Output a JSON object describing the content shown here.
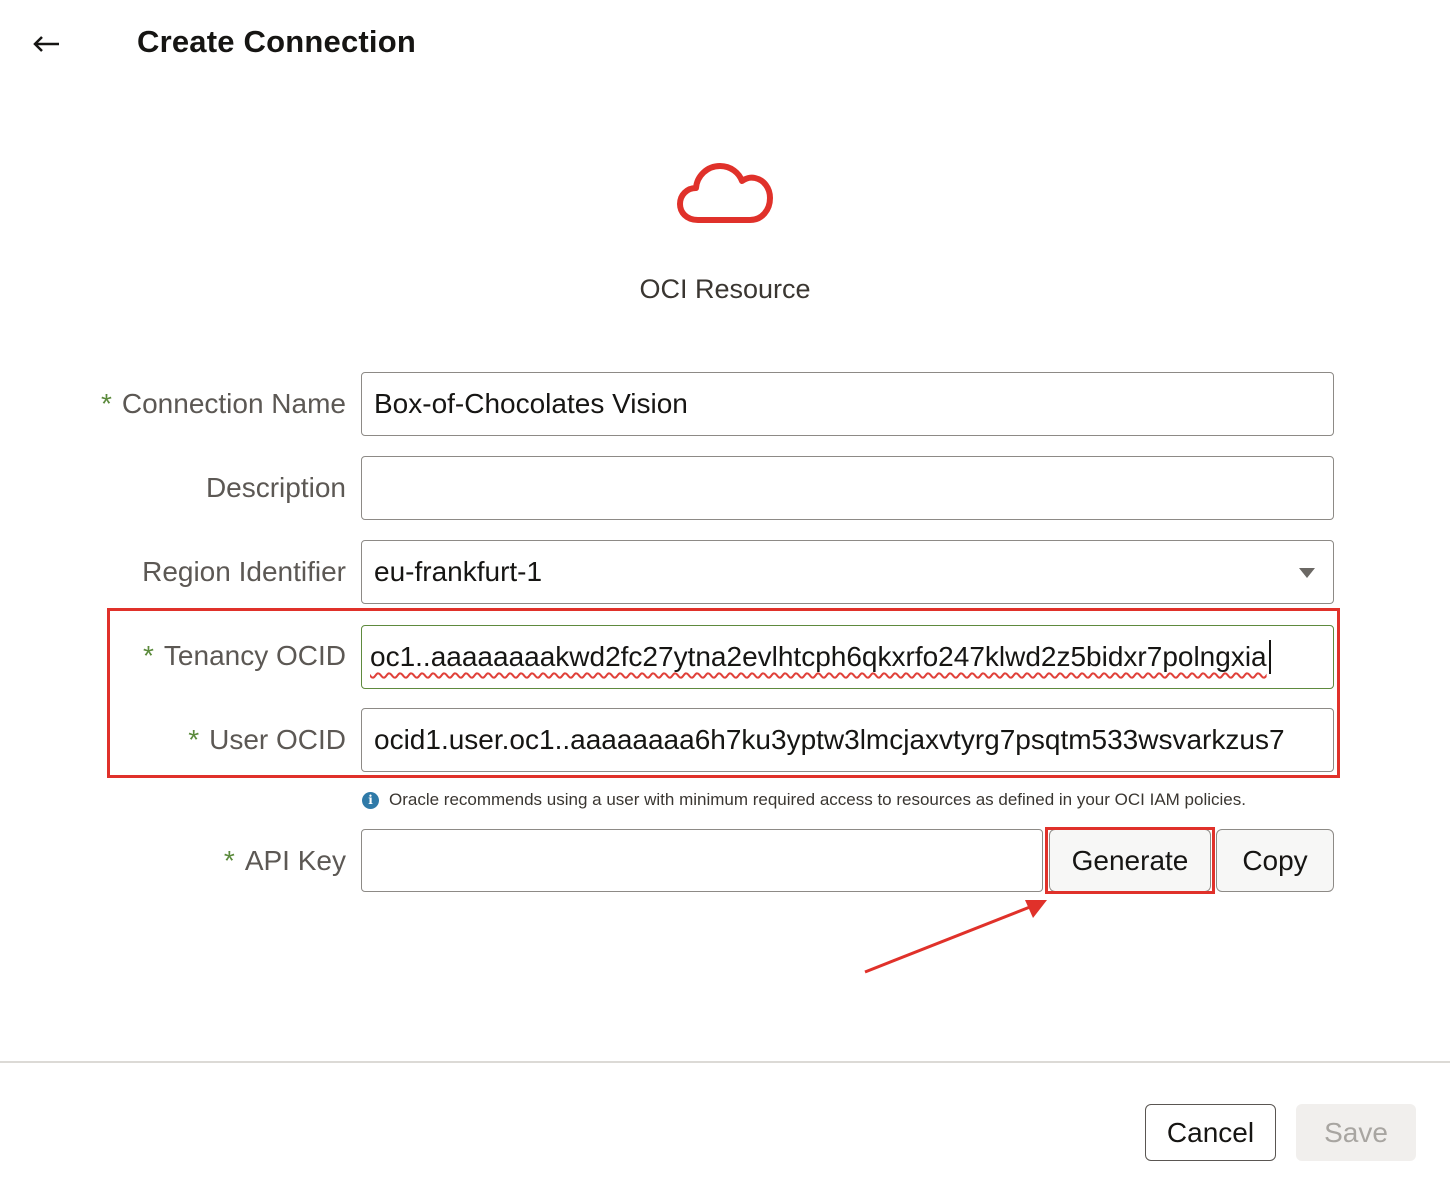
{
  "header": {
    "back_icon": "arrow-left-icon",
    "title": "Create Connection"
  },
  "resource": {
    "icon": "cloud-icon",
    "icon_color": "#e0312a",
    "label": "OCI Resource"
  },
  "form": {
    "required_marker": "*",
    "connection_name": {
      "label": "Connection Name",
      "value": "Box-of-Chocolates Vision"
    },
    "description": {
      "label": "Description",
      "value": ""
    },
    "region": {
      "label": "Region Identifier",
      "value": "eu-frankfurt-1"
    },
    "tenancy_ocid": {
      "label": "Tenancy OCID",
      "value": "oc1..aaaaaaaakwd2fc27ytna2evlhtcph6qkxrfo247klwd2z5bidxr7polngxia"
    },
    "user_ocid": {
      "label": "User OCID",
      "value": "ocid1.user.oc1..aaaaaaaa6h7ku3yptw3lmcjaxvtyrg7psqtm533wsvarkzus7"
    },
    "hint": "Oracle recommends using a user with minimum required access to resources as defined in your OCI IAM policies.",
    "api_key": {
      "label": "API Key",
      "value": "",
      "generate_label": "Generate",
      "copy_label": "Copy"
    }
  },
  "footer": {
    "cancel_label": "Cancel",
    "save_label": "Save"
  },
  "colors": {
    "highlight": "#e0312a",
    "required": "#5b8a3c",
    "info": "#2f7aa8"
  }
}
